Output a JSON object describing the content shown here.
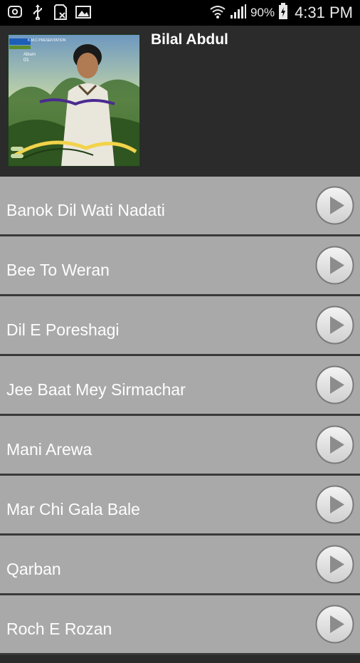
{
  "status_bar": {
    "battery": "90%",
    "time": "4:31 PM",
    "left_icons": [
      "messenger-icon",
      "usb-icon",
      "sd-card-icon",
      "image-icon"
    ],
    "right_icons": [
      "wifi-icon",
      "signal-icon",
      "battery-charging-icon"
    ]
  },
  "album": {
    "title": "Bilal Abdul",
    "art_text": {
      "presenter": "K.M.C PRESENTATION",
      "album_label": "Album",
      "album_number": "01"
    }
  },
  "tracks": [
    {
      "title": "Banok Dil Wati Nadati"
    },
    {
      "title": "Bee To Weran"
    },
    {
      "title": "Dil E Poreshagi"
    },
    {
      "title": "Jee Baat Mey Sirmachar"
    },
    {
      "title": "Mani Arewa"
    },
    {
      "title": "Mar Chi Gala Bale"
    },
    {
      "title": "Qarban"
    },
    {
      "title": "Roch E Rozan"
    }
  ],
  "colors": {
    "row_bg": "#a9a9a9",
    "row_divider": "#3a3a3a",
    "header_bg": "#2b2b2b",
    "text": "#ffffff"
  }
}
